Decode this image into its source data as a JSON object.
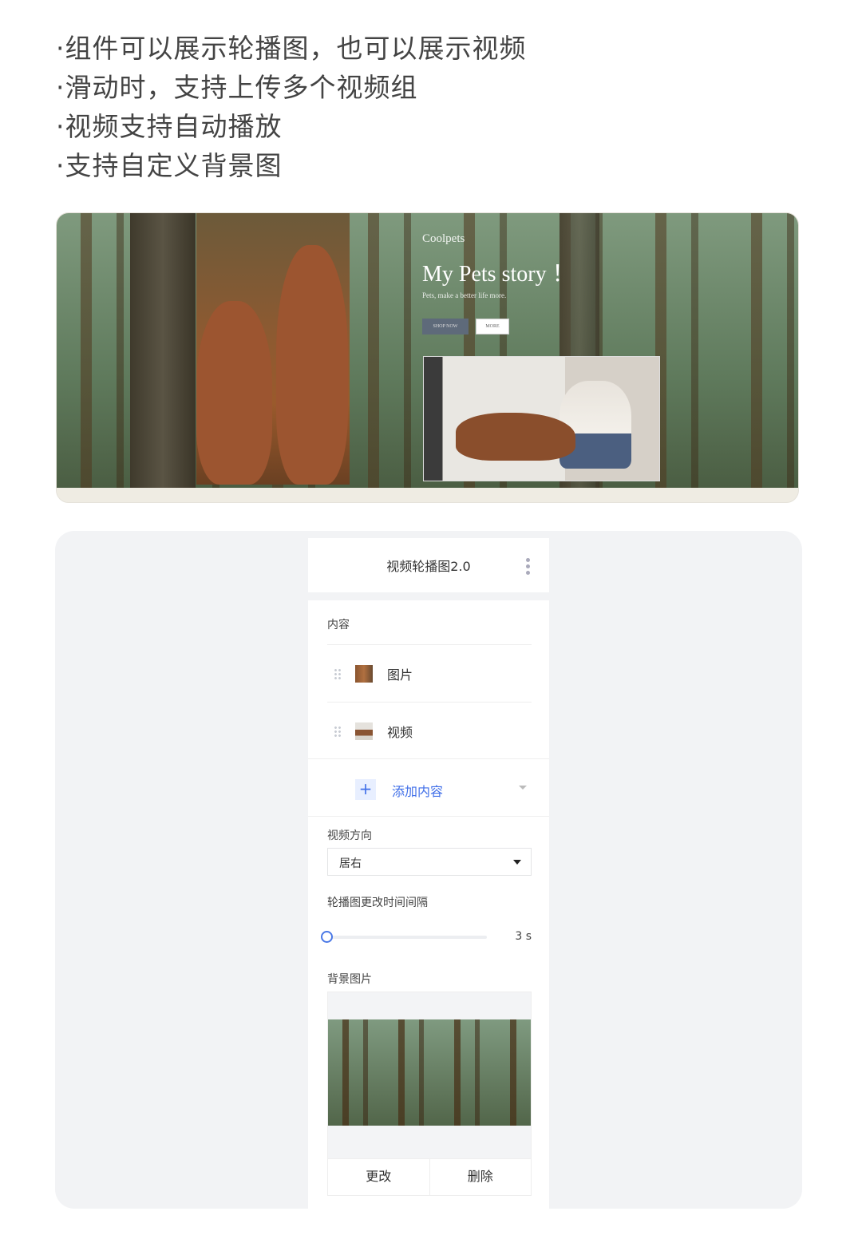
{
  "bullets": [
    "·组件可以展示轮播图，也可以展示视频",
    "·滑动时，支持上传多个视频组",
    "·视频支持自动播放",
    "·支持自定义背景图"
  ],
  "banner": {
    "brand": "Coolpets",
    "title": "My Pets story ！",
    "subtitle": "Pets, make a better life more.",
    "shop_label": "SHOP NOW",
    "more_label": "MORE"
  },
  "panel": {
    "title": "视频轮播图2.0",
    "content_label": "内容",
    "items": [
      {
        "label": "图片",
        "icon": "image-thumbnail"
      },
      {
        "label": "视频",
        "icon": "video-thumbnail"
      }
    ],
    "add_label": "添加内容",
    "direction_label": "视频方向",
    "direction_value": "居右",
    "interval_label": "轮播图更改时间间隔",
    "interval_value": "3 s",
    "interval_seconds": 3,
    "bg_label": "背景图片",
    "change_label": "更改",
    "delete_label": "删除"
  },
  "colors": {
    "accent": "#3f6ee8",
    "panel_bg": "#f2f3f5"
  }
}
